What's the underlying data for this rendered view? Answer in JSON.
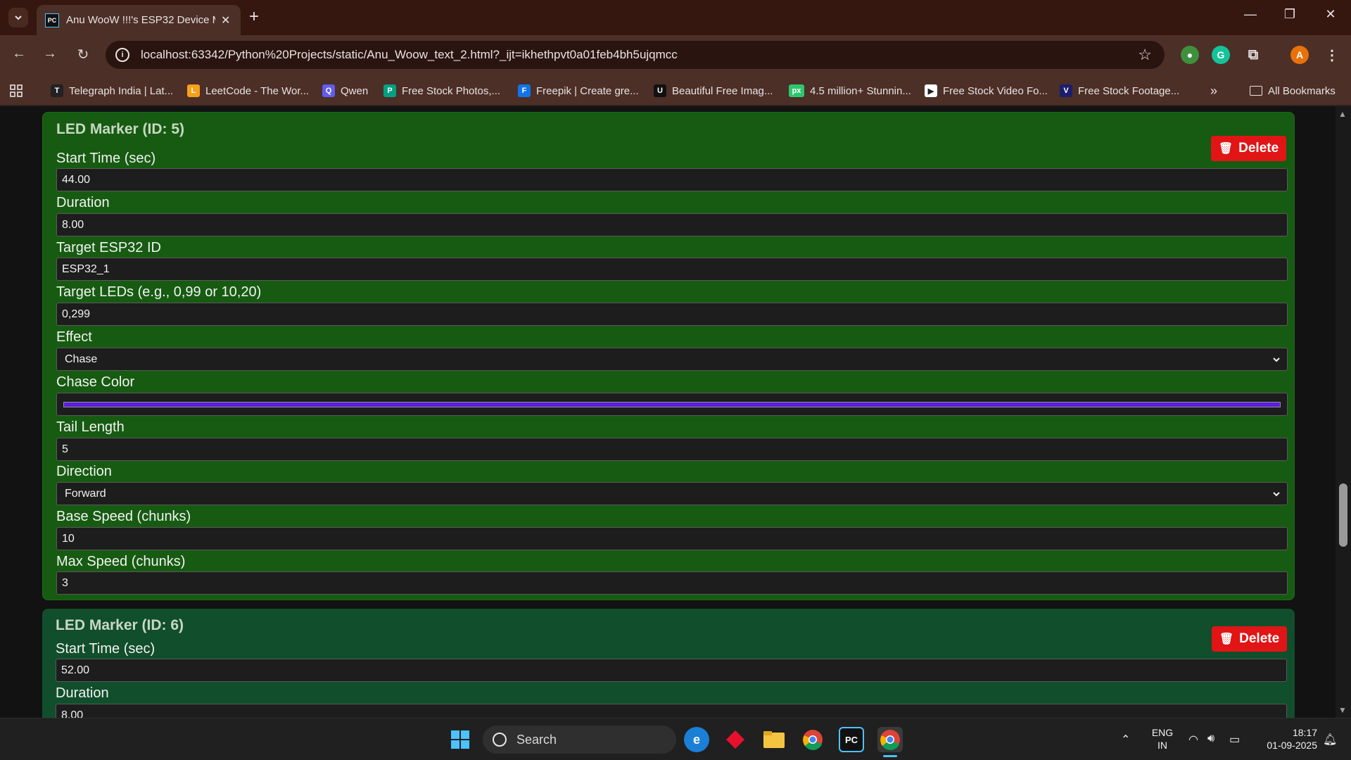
{
  "browser": {
    "tab_title": "Anu WooW !!!'s ESP32 Device M",
    "tab_favicon": "PC",
    "url": "localhost:63342/Python%20Projects/static/Anu_Woow_text_2.html?_ijt=ikhethpvt0a01feb4bh5ujqmcc",
    "profile_initial": "A",
    "bookmarks": [
      {
        "label": "Telegraph India | Lat...",
        "icon": "T"
      },
      {
        "label": "LeetCode - The Wor...",
        "icon": "L"
      },
      {
        "label": "Qwen",
        "icon": "Q"
      },
      {
        "label": "Free Stock Photos,...",
        "icon": "P"
      },
      {
        "label": "Freepik | Create gre...",
        "icon": "F"
      },
      {
        "label": "Beautiful Free Imag...",
        "icon": "U"
      },
      {
        "label": "4.5 million+ Stunnin...",
        "icon": "px"
      },
      {
        "label": "Free Stock Video Fo...",
        "icon": "▶"
      },
      {
        "label": "Free Stock Footage...",
        "icon": "V"
      }
    ],
    "all_bookmarks_label": "All Bookmarks"
  },
  "markers": [
    {
      "title": "LED Marker (ID: 5)",
      "delete_label": "Delete",
      "fields": {
        "start_time": {
          "label": "Start Time (sec)",
          "value": "44.00"
        },
        "duration": {
          "label": "Duration",
          "value": "8.00"
        },
        "target_esp": {
          "label": "Target ESP32 ID",
          "value": "ESP32_1"
        },
        "target_leds": {
          "label": "Target LEDs (e.g., 0,99 or 10,20)",
          "value": "0,299"
        },
        "effect": {
          "label": "Effect",
          "value": "Chase"
        },
        "chase_color": {
          "label": "Chase Color",
          "value": "#5b1fe0"
        },
        "tail_length": {
          "label": "Tail Length",
          "value": "5"
        },
        "direction": {
          "label": "Direction",
          "value": "Forward"
        },
        "base_speed": {
          "label": "Base Speed (chunks)",
          "value": "10"
        },
        "max_speed": {
          "label": "Max Speed (chunks)",
          "value": "3"
        }
      }
    },
    {
      "title": "LED Marker (ID: 6)",
      "delete_label": "Delete",
      "fields": {
        "start_time": {
          "label": "Start Time (sec)",
          "value": "52.00"
        },
        "duration": {
          "label": "Duration",
          "value": "8.00"
        }
      }
    }
  ],
  "taskbar": {
    "search_placeholder": "Search",
    "language": "ENG",
    "region": "IN",
    "time": "18:17",
    "date": "01-09-2025"
  },
  "colors": {
    "marker_active_bg": "#165b11",
    "marker_bg": "#114e2b",
    "delete_red": "#e11515",
    "chase_color": "#5b1fe0"
  }
}
